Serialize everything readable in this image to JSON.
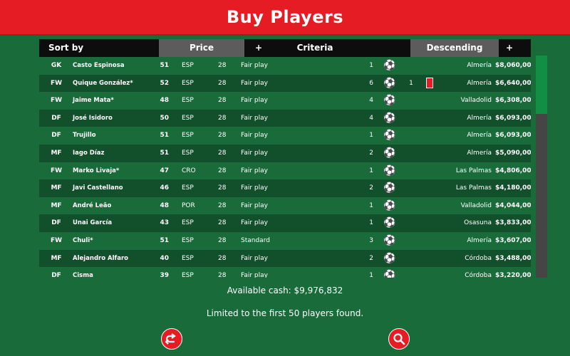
{
  "title": "Buy Players",
  "header": {
    "sort_by": "Sort by",
    "sort_field": "Price",
    "plus": "+",
    "criteria": "Criteria",
    "order": "Descending"
  },
  "players": [
    {
      "pos": "GK",
      "name": "Casto Espinosa",
      "rating": "51",
      "nat": "ESP",
      "age": "28",
      "criteria": "Fair play",
      "num": "1",
      "extra": "",
      "card": false,
      "club": "Almería",
      "price": "$8,060,000"
    },
    {
      "pos": "FW",
      "name": "Quique González*",
      "rating": "52",
      "nat": "ESP",
      "age": "28",
      "criteria": "Fair play",
      "num": "6",
      "extra": "1",
      "card": true,
      "club": "Almería",
      "price": "$6,640,000"
    },
    {
      "pos": "FW",
      "name": "Jaime Mata*",
      "rating": "48",
      "nat": "ESP",
      "age": "28",
      "criteria": "Fair play",
      "num": "4",
      "extra": "",
      "card": false,
      "club": "Valladolid",
      "price": "$6,308,000"
    },
    {
      "pos": "DF",
      "name": "José Isidoro",
      "rating": "50",
      "nat": "ESP",
      "age": "28",
      "criteria": "Fair play",
      "num": "4",
      "extra": "",
      "card": false,
      "club": "Almería",
      "price": "$6,093,000"
    },
    {
      "pos": "DF",
      "name": "Trujillo",
      "rating": "51",
      "nat": "ESP",
      "age": "28",
      "criteria": "Fair play",
      "num": "1",
      "extra": "",
      "card": false,
      "club": "Almería",
      "price": "$6,093,000"
    },
    {
      "pos": "MF",
      "name": "Iago Díaz",
      "rating": "51",
      "nat": "ESP",
      "age": "28",
      "criteria": "Fair play",
      "num": "2",
      "extra": "",
      "card": false,
      "club": "Almería",
      "price": "$5,090,000"
    },
    {
      "pos": "FW",
      "name": "Marko Livaja*",
      "rating": "47",
      "nat": "CRO",
      "age": "28",
      "criteria": "Fair play",
      "num": "1",
      "extra": "",
      "card": false,
      "club": "Las Palmas",
      "price": "$4,806,000"
    },
    {
      "pos": "MF",
      "name": "Javi Castellano",
      "rating": "46",
      "nat": "ESP",
      "age": "28",
      "criteria": "Fair play",
      "num": "2",
      "extra": "",
      "card": false,
      "club": "Las Palmas",
      "price": "$4,180,000"
    },
    {
      "pos": "MF",
      "name": "André Leão",
      "rating": "48",
      "nat": "POR",
      "age": "28",
      "criteria": "Fair play",
      "num": "1",
      "extra": "",
      "card": false,
      "club": "Valladolid",
      "price": "$4,044,000"
    },
    {
      "pos": "DF",
      "name": "Unai García",
      "rating": "43",
      "nat": "ESP",
      "age": "28",
      "criteria": "Fair play",
      "num": "1",
      "extra": "",
      "card": false,
      "club": "Osasuna",
      "price": "$3,833,000"
    },
    {
      "pos": "FW",
      "name": "Chuli*",
      "rating": "51",
      "nat": "ESP",
      "age": "28",
      "criteria": "Standard",
      "num": "3",
      "extra": "",
      "card": false,
      "club": "Almería",
      "price": "$3,607,000"
    },
    {
      "pos": "MF",
      "name": "Alejandro Alfaro",
      "rating": "40",
      "nat": "ESP",
      "age": "28",
      "criteria": "Fair play",
      "num": "2",
      "extra": "",
      "card": false,
      "club": "Córdoba",
      "price": "$3,488,000"
    },
    {
      "pos": "DF",
      "name": "Cisma",
      "rating": "39",
      "nat": "ESP",
      "age": "28",
      "criteria": "Fair play",
      "num": "1",
      "extra": "",
      "card": false,
      "club": "Córdoba",
      "price": "$3,220,000"
    }
  ],
  "available_cash": "Available cash: $9,976,832",
  "limit_note": "Limited to the first 50 players found.",
  "icons": {
    "ball": "soccer-ball-icon",
    "back": "back-arrow-icon",
    "search": "search-icon"
  },
  "colors": {
    "title_bar": "#e61c24",
    "background": "#1a6b3a",
    "scroll_thumb": "#109040"
  }
}
